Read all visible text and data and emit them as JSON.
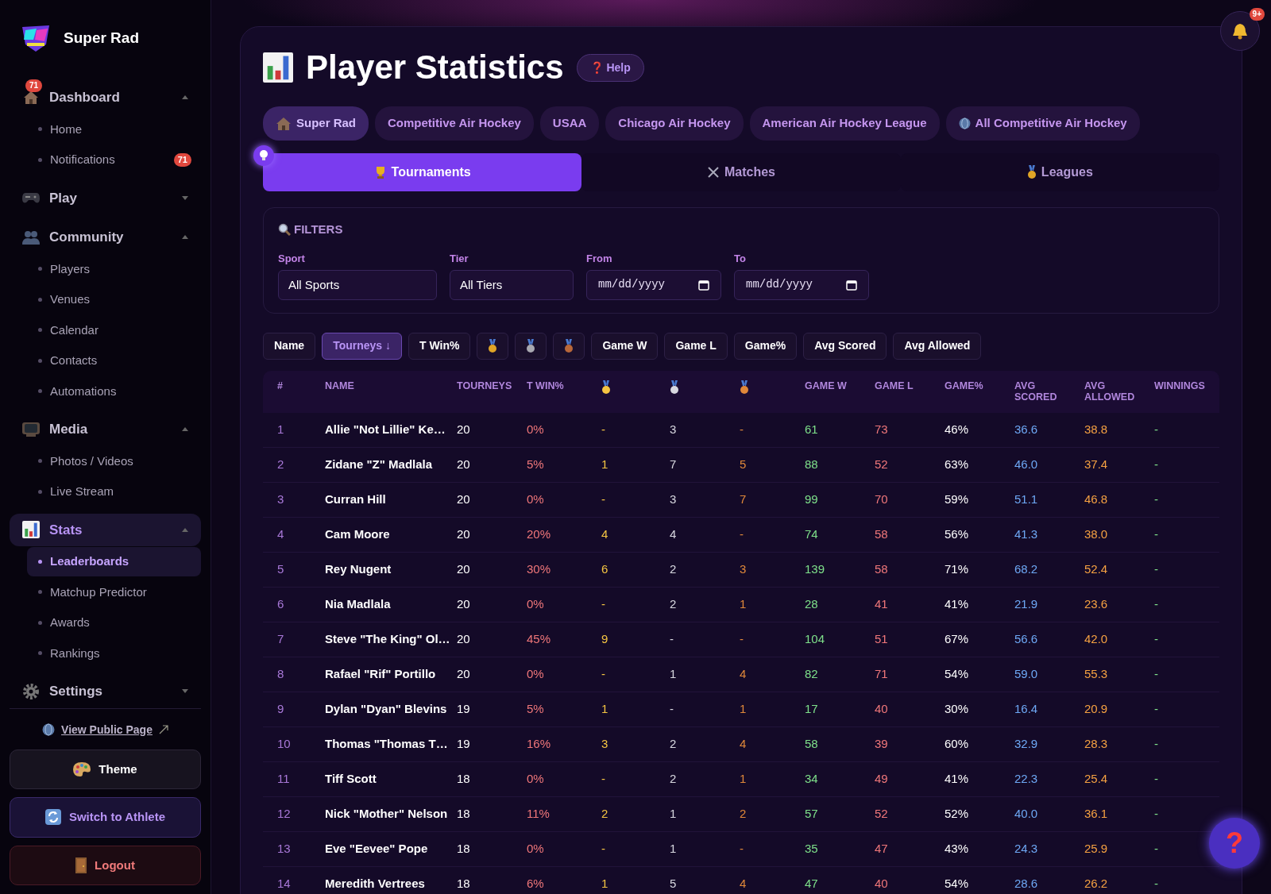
{
  "brand": {
    "title": "Super Rad"
  },
  "sidebar": {
    "sections": [
      {
        "label": "Dashboard",
        "badge": "71",
        "expanded": true,
        "selected": false,
        "children": [
          {
            "label": "Home",
            "selected": false
          },
          {
            "label": "Notifications",
            "selected": false,
            "badge": "71"
          }
        ]
      },
      {
        "label": "Play",
        "expanded": false,
        "selected": false
      },
      {
        "label": "Community",
        "expanded": true,
        "selected": false,
        "children": [
          {
            "label": "Players",
            "selected": false
          },
          {
            "label": "Venues",
            "selected": false
          },
          {
            "label": "Calendar",
            "selected": false
          },
          {
            "label": "Contacts",
            "selected": false
          },
          {
            "label": "Automations",
            "selected": false
          }
        ]
      },
      {
        "label": "Media",
        "expanded": true,
        "selected": false,
        "children": [
          {
            "label": "Photos / Videos",
            "selected": false
          },
          {
            "label": "Live Stream",
            "selected": false
          }
        ]
      },
      {
        "label": "Stats",
        "expanded": true,
        "selected": true,
        "children": [
          {
            "label": "Leaderboards",
            "selected": true
          },
          {
            "label": "Matchup Predictor",
            "selected": false
          },
          {
            "label": "Awards",
            "selected": false
          },
          {
            "label": "Rankings",
            "selected": false
          }
        ]
      },
      {
        "label": "Settings",
        "expanded": false,
        "selected": false
      }
    ],
    "public_link": "View Public Page",
    "buttons": [
      {
        "label": "Theme",
        "kind": "theme"
      },
      {
        "label": "Switch to Athlete",
        "kind": "switch"
      },
      {
        "label": "Logout",
        "kind": "logout"
      }
    ]
  },
  "notifications": {
    "badge": "9+"
  },
  "page": {
    "title": "Player Statistics",
    "help": "❓ Help"
  },
  "scopes": [
    {
      "label": "Super Rad",
      "selected": true,
      "kind": "home"
    },
    {
      "label": "Competitive Air Hockey",
      "selected": false
    },
    {
      "label": "USAA",
      "selected": false
    },
    {
      "label": "Chicago Air Hockey",
      "selected": false
    },
    {
      "label": "American Air Hockey League",
      "selected": false
    },
    {
      "label": "All Competitive Air Hockey",
      "selected": false,
      "kind": "globe"
    }
  ],
  "tabs": [
    {
      "label": "Tournaments",
      "selected": true,
      "kind": "trophy"
    },
    {
      "label": "Matches",
      "selected": false,
      "kind": "swords"
    },
    {
      "label": "Leagues",
      "selected": false,
      "kind": "medal"
    }
  ],
  "filters": {
    "title": "FILTERS",
    "fields": [
      {
        "label": "Sport",
        "kind": "select",
        "value": "All Sports"
      },
      {
        "label": "Tier",
        "kind": "select",
        "value": "All Tiers"
      },
      {
        "label": "From",
        "kind": "date",
        "placeholder": "mm/dd/yyyy"
      },
      {
        "label": "To",
        "kind": "date",
        "placeholder": "mm/dd/yyyy"
      }
    ]
  },
  "sort_buttons": [
    {
      "label": "Name",
      "selected": false
    },
    {
      "label": "Tourneys ↓",
      "selected": true
    },
    {
      "label": "T Win%",
      "selected": false
    },
    {
      "kind": "medal",
      "color": "#e0a526",
      "selected": false
    },
    {
      "kind": "medal",
      "color": "#a8a8b0",
      "selected": false
    },
    {
      "kind": "medal",
      "color": "#b8673a",
      "selected": false
    },
    {
      "label": "Game W",
      "selected": false
    },
    {
      "label": "Game L",
      "selected": false
    },
    {
      "label": "Game%",
      "selected": false
    },
    {
      "label": "Avg Scored",
      "selected": false
    },
    {
      "label": "Avg Allowed",
      "selected": false
    }
  ],
  "table": {
    "columns": [
      {
        "label": "#",
        "color": "#a878d8"
      },
      {
        "label": "NAME",
        "color": "#ffffff"
      },
      {
        "label": "TOURNEYS",
        "color": "#ffffff"
      },
      {
        "label": "T WIN%",
        "color": "#f0777a"
      },
      {
        "kind": "medal",
        "color": "#f5c542"
      },
      {
        "kind": "medal",
        "color": "#d8d8e0"
      },
      {
        "kind": "medal",
        "color": "#e0883a"
      },
      {
        "label": "GAME W",
        "color": "#7ee08a"
      },
      {
        "label": "GAME L",
        "color": "#f0777a"
      },
      {
        "label": "GAME%",
        "color": "#ffffff"
      },
      {
        "label": "AVG SCORED",
        "color": "#6ea8f5"
      },
      {
        "label": "AVG ALLOWED",
        "color": "#f5a142"
      },
      {
        "label": "WINNINGS",
        "color": "#7ee08a"
      }
    ],
    "rows": [
      [
        "1",
        "Allie \"Not Lillie\" Ke…",
        "20",
        "0%",
        "-",
        "3",
        "-",
        "61",
        "73",
        "46%",
        "36.6",
        "38.8",
        "-"
      ],
      [
        "2",
        "Zidane \"Z\" Madlala",
        "20",
        "5%",
        "1",
        "7",
        "5",
        "88",
        "52",
        "63%",
        "46.0",
        "37.4",
        "-"
      ],
      [
        "3",
        "Curran Hill",
        "20",
        "0%",
        "-",
        "3",
        "7",
        "99",
        "70",
        "59%",
        "51.1",
        "46.8",
        "-"
      ],
      [
        "4",
        "Cam Moore",
        "20",
        "20%",
        "4",
        "4",
        "-",
        "74",
        "58",
        "56%",
        "41.3",
        "38.0",
        "-"
      ],
      [
        "5",
        "Rey Nugent",
        "20",
        "30%",
        "6",
        "2",
        "3",
        "139",
        "58",
        "71%",
        "68.2",
        "52.4",
        "-"
      ],
      [
        "6",
        "Nia Madlala",
        "20",
        "0%",
        "-",
        "2",
        "1",
        "28",
        "41",
        "41%",
        "21.9",
        "23.6",
        "-"
      ],
      [
        "7",
        "Steve \"The King\" Ol…",
        "20",
        "45%",
        "9",
        "-",
        "-",
        "104",
        "51",
        "67%",
        "56.6",
        "42.0",
        "-"
      ],
      [
        "8",
        "Rafael \"Rif\" Portillo",
        "20",
        "0%",
        "-",
        "1",
        "4",
        "82",
        "71",
        "54%",
        "59.0",
        "55.3",
        "-"
      ],
      [
        "9",
        "Dylan \"Dyan\" Blevins",
        "19",
        "5%",
        "1",
        "-",
        "1",
        "17",
        "40",
        "30%",
        "16.4",
        "20.9",
        "-"
      ],
      [
        "10",
        "Thomas \"Thomas T…",
        "19",
        "16%",
        "3",
        "2",
        "4",
        "58",
        "39",
        "60%",
        "32.9",
        "28.3",
        "-"
      ],
      [
        "11",
        "Tiff Scott",
        "18",
        "0%",
        "-",
        "2",
        "1",
        "34",
        "49",
        "41%",
        "22.3",
        "25.4",
        "-"
      ],
      [
        "12",
        "Nick \"Mother\" Nelson",
        "18",
        "11%",
        "2",
        "1",
        "2",
        "57",
        "52",
        "52%",
        "40.0",
        "36.1",
        "-"
      ],
      [
        "13",
        "Eve \"Eevee\" Pope",
        "18",
        "0%",
        "-",
        "1",
        "-",
        "35",
        "47",
        "43%",
        "24.3",
        "25.9",
        "-"
      ],
      [
        "14",
        "Meredith Vertrees",
        "18",
        "6%",
        "1",
        "5",
        "4",
        "47",
        "40",
        "54%",
        "28.6",
        "26.2",
        "-"
      ]
    ]
  },
  "help_button": {
    "label": "?"
  }
}
